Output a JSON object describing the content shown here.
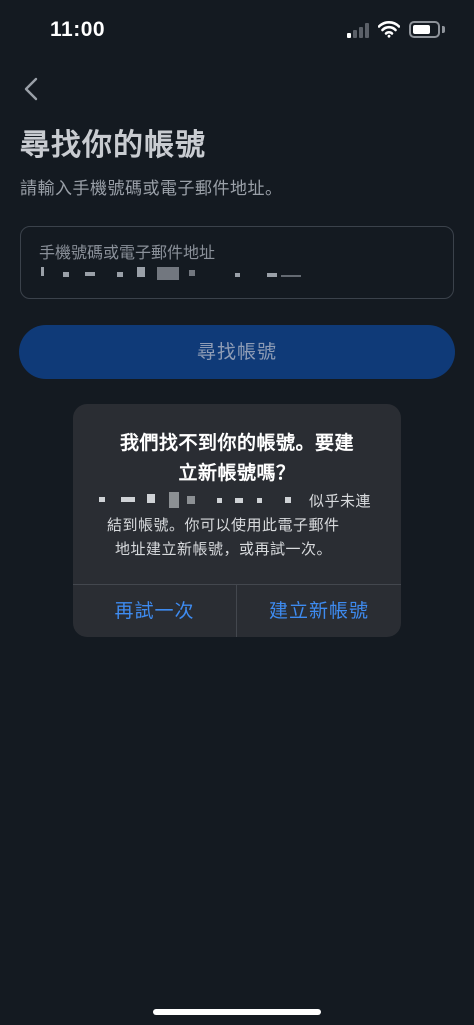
{
  "status_bar": {
    "time": "11:00"
  },
  "page": {
    "title": "尋找你的帳號",
    "subtitle": "請輸入手機號碼或電子郵件地址。",
    "field_label": "手機號碼或電子郵件地址",
    "find_button": "尋找帳號"
  },
  "dialog": {
    "title_line1": "我們找不到你的帳號。要建",
    "title_line2": "立新帳號嗎？",
    "message_line1_suffix": "似乎未連",
    "message_line2": "結到帳號。你可以使用此電子郵件",
    "message_line3": "地址建立新帳號，或再試一次。",
    "retry_button": "再試一次",
    "create_button": "建立新帳號"
  },
  "colors": {
    "background": "#141a21",
    "primary_button": "#0f3a78",
    "dialog_bg": "#2a2d33",
    "link_blue": "#3e8bf0"
  },
  "icons": [
    "back-chevron-icon",
    "cellular-signal-icon",
    "wifi-icon",
    "battery-icon"
  ]
}
